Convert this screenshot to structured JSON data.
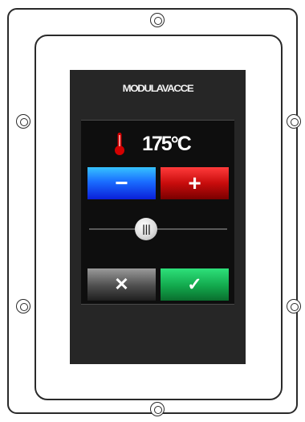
{
  "device": {
    "brand": "MODULAVACCE"
  },
  "display": {
    "temperature": "175°C",
    "thermometer_icon": "thermometer-icon"
  },
  "buttons": {
    "decrease_label": "−",
    "increase_label": "+",
    "cancel_label": "✕",
    "confirm_label": "✓"
  },
  "slider": {
    "grip_label": "|||"
  },
  "colors": {
    "decrease": "#1a6dff",
    "increase": "#c80c0c",
    "cancel": "#4d4d4d",
    "confirm": "#12a84c",
    "thermometer": "#d40000"
  }
}
